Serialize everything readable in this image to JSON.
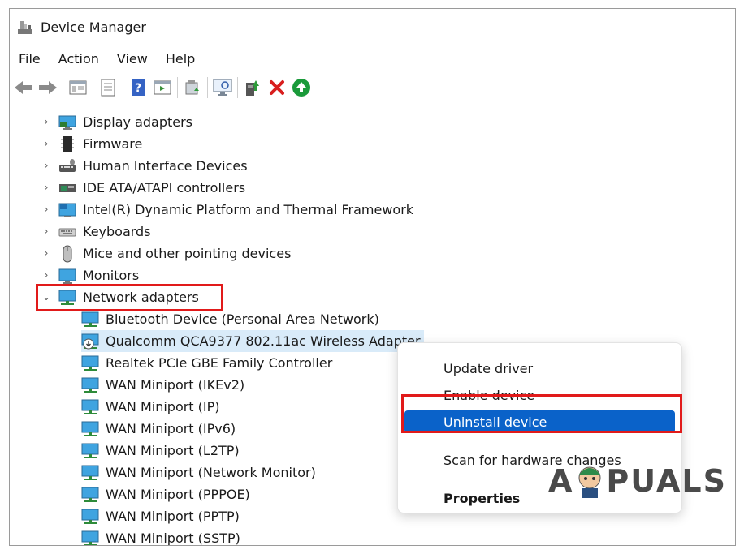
{
  "window": {
    "title": "Device Manager"
  },
  "menu": [
    "File",
    "Action",
    "View",
    "Help"
  ],
  "toolbar": {
    "icons": [
      "back-arrow-icon",
      "forward-arrow-icon",
      "properties-icon",
      "list-icon",
      "help-icon",
      "show-hidden-icon",
      "scan-hardware-icon",
      "monitor-icon",
      "update-driver-icon",
      "uninstall-x-icon",
      "enable-device-icon"
    ],
    "colors": {
      "uninstall": "#d81e1e",
      "enable": "#1a9a3a"
    }
  },
  "tree": {
    "categories": [
      {
        "label": "Display adapters",
        "icon": "display-adapter-icon"
      },
      {
        "label": "Firmware",
        "icon": "firmware-icon"
      },
      {
        "label": "Human Interface Devices",
        "icon": "hid-icon"
      },
      {
        "label": "IDE ATA/ATAPI controllers",
        "icon": "ide-controller-icon"
      },
      {
        "label": "Intel(R) Dynamic Platform and Thermal Framework",
        "icon": "intel-platform-icon"
      },
      {
        "label": "Keyboards",
        "icon": "keyboard-icon"
      },
      {
        "label": "Mice and other pointing devices",
        "icon": "mouse-icon"
      },
      {
        "label": "Monitors",
        "icon": "monitor-icon"
      },
      {
        "label": "Network adapters",
        "icon": "network-adapter-icon",
        "expanded": true
      }
    ],
    "network_children": [
      "Bluetooth Device (Personal Area Network)",
      "Qualcomm QCA9377 802.11ac Wireless Adapter",
      "Realtek PCIe GBE Family Controller",
      "WAN Miniport (IKEv2)",
      "WAN Miniport (IP)",
      "WAN Miniport (IPv6)",
      "WAN Miniport (L2TP)",
      "WAN Miniport (Network Monitor)",
      "WAN Miniport (PPPOE)",
      "WAN Miniport (PPTP)",
      "WAN Miniport (SSTP)"
    ]
  },
  "context_menu": {
    "items": [
      "Update driver",
      "Enable device",
      "Uninstall device",
      "Scan for hardware changes",
      "Properties"
    ],
    "active_color": "#0a62c9"
  },
  "annotation_color": "#e11a1a",
  "watermark": {
    "left": "A",
    "right": "PUALS"
  }
}
